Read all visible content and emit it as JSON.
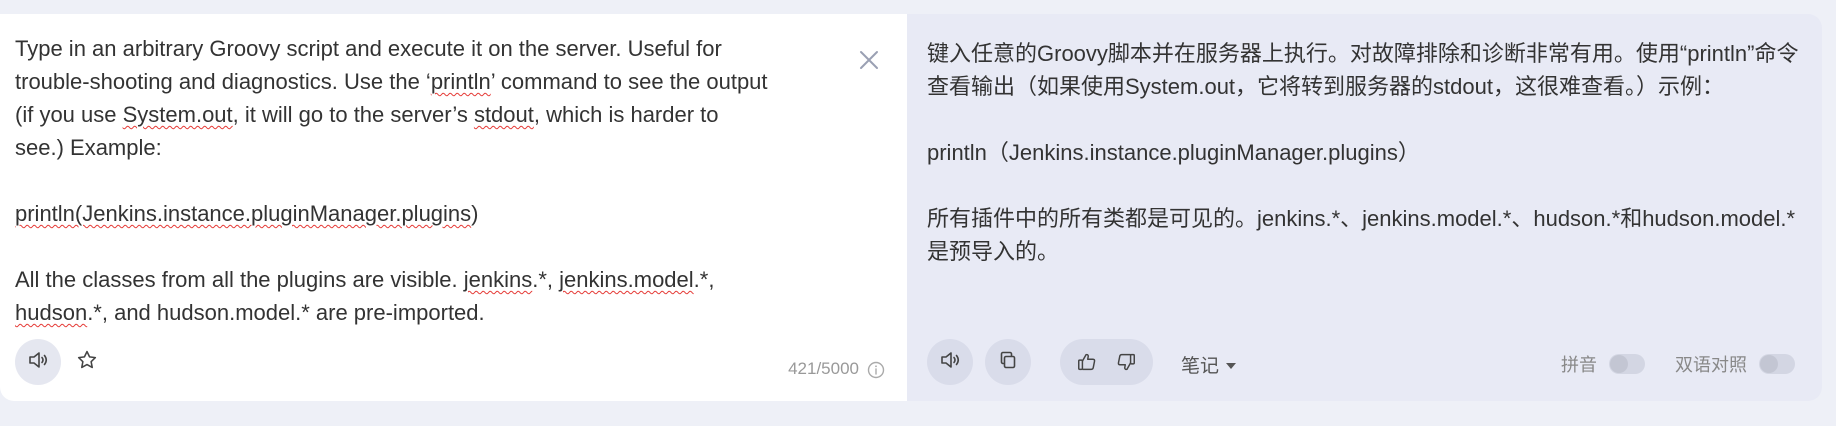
{
  "source": {
    "paragraphs": [
      [
        {
          "t": "Type in an arbitrary Groovy script and execute it on the server. Useful for\ntrouble-shooting and diagnostics. Use the ‘"
        },
        {
          "t": "println",
          "sq": true
        },
        {
          "t": "’ command to see the output\n(if you use "
        },
        {
          "t": "System.out",
          "sq": true
        },
        {
          "t": ", it will go to the server’s "
        },
        {
          "t": "stdout",
          "sq": true
        },
        {
          "t": ", which is harder to\nsee.) Example:"
        }
      ],
      [],
      [
        {
          "t": "println(Jenkins.instance.pluginManager.plugins",
          "sq": true
        },
        {
          "t": ")"
        }
      ],
      [],
      [
        {
          "t": "All the classes from all the plugins are visible. "
        },
        {
          "t": "jenkins",
          "sq": true
        },
        {
          "t": ".*, "
        },
        {
          "t": "jenkins.model",
          "sq": true
        },
        {
          "t": ".*,\n"
        },
        {
          "t": "hudson",
          "sq": true
        },
        {
          "t": ".*, and hudson.model.* are pre-imported."
        }
      ]
    ],
    "counter": "421/5000",
    "icons": {
      "speaker": "speaker-icon",
      "star": "star-icon",
      "close": "close-icon",
      "info": "info-icon"
    }
  },
  "target": {
    "paragraphs": [
      "键入任意的Groovy脚本并在服务器上执行。对故障排除和诊断非常有用。使用“println”命令查看输出（如果使用System.out，它将转到服务器的stdout，这很难查看。）示例：",
      "",
      "println（Jenkins.instance.pluginManager.plugins）",
      "",
      "所有插件中的所有类都是可见的。jenkins.*、jenkins.model.*、hudson.*和hudson.model.*是预导入的。"
    ],
    "notes_label": "笔记",
    "pinyin_label": "拼音",
    "bilingual_label": "双语对照",
    "pinyin_on": false,
    "bilingual_on": false,
    "icons": {
      "speaker": "speaker-icon",
      "copy": "copy-icon",
      "like": "thumbs-up-icon",
      "dislike": "thumbs-down-icon",
      "caret": "caret-down-icon"
    }
  },
  "colors": {
    "page_bg": "#eef0f7",
    "target_bg": "#e8eaf5",
    "squiggle": "#e53935"
  }
}
